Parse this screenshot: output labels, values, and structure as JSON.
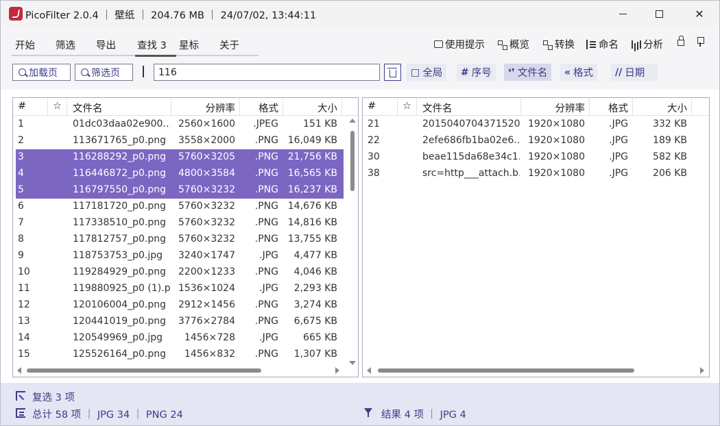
{
  "window": {
    "title": "PicoFilter 2.0.4 ｜ 壁纸 ｜ 204.76 MB ｜ 24/07/02, 13:44:11",
    "controls": {
      "minimize": "",
      "maximize": "",
      "close": "✕"
    }
  },
  "menu": {
    "tabs": [
      {
        "label": "开始"
      },
      {
        "label": "筛选"
      },
      {
        "label": "导出"
      },
      {
        "label": "查找 3",
        "active": true
      },
      {
        "label": "星标"
      },
      {
        "label": "关于"
      }
    ],
    "tools": [
      {
        "label": "使用提示",
        "icon": "speech-bubble-icon"
      },
      {
        "label": "概览",
        "icon": "overview-icon"
      },
      {
        "label": "转换",
        "icon": "convert-icon"
      },
      {
        "label": "命名",
        "icon": "rename-icon"
      },
      {
        "label": "分析",
        "icon": "bar-chart-icon"
      }
    ]
  },
  "search": {
    "load_page_label": "加载页",
    "filter_page_label": "筛选页",
    "query": "116",
    "scopes": [
      {
        "label": "全局",
        "icon": "□",
        "active": false
      },
      {
        "label": "序号",
        "icon": "#",
        "active": false
      },
      {
        "label": "文件名",
        "icon": "❛❜",
        "active": true
      },
      {
        "label": "格式",
        "icon": "«",
        "active": false
      },
      {
        "label": "日期",
        "icon": "//",
        "active": false
      }
    ]
  },
  "left_table": {
    "headers": {
      "index": "#",
      "star": "☆",
      "name": "文件名",
      "resolution": "分辨率",
      "format": "格式",
      "size": "大小"
    },
    "rows": [
      {
        "index": "1",
        "name": "01dc03daa02e900...",
        "resolution": "2560×1600",
        "format": ".JPEG",
        "size": "151 KB",
        "selected": false
      },
      {
        "index": "2",
        "name": "113671765_p0.png",
        "resolution": "3558×2000",
        "format": ".PNG",
        "size": "16,049 KB",
        "selected": false
      },
      {
        "index": "3",
        "name": "116288292_p0.png",
        "resolution": "5760×3205",
        "format": ".PNG",
        "size": "21,756 KB",
        "selected": true
      },
      {
        "index": "4",
        "name": "116446872_p0.png",
        "resolution": "4800×3584",
        "format": ".PNG",
        "size": "16,565 KB",
        "selected": true
      },
      {
        "index": "5",
        "name": "116797550_p0.png",
        "resolution": "5760×3232",
        "format": ".PNG",
        "size": "16,237 KB",
        "selected": true
      },
      {
        "index": "6",
        "name": "117181720_p0.png",
        "resolution": "5760×3232",
        "format": ".PNG",
        "size": "14,676 KB",
        "selected": false
      },
      {
        "index": "7",
        "name": "117338510_p0.png",
        "resolution": "5760×3232",
        "format": ".PNG",
        "size": "14,816 KB",
        "selected": false
      },
      {
        "index": "8",
        "name": "117812757_p0.png",
        "resolution": "5760×3232",
        "format": ".PNG",
        "size": "13,755 KB",
        "selected": false
      },
      {
        "index": "9",
        "name": "118753753_p0.jpg",
        "resolution": "3240×1747",
        "format": ".JPG",
        "size": "4,477 KB",
        "selected": false
      },
      {
        "index": "10",
        "name": "119284929_p0.png",
        "resolution": "2200×1233",
        "format": ".PNG",
        "size": "4,046 KB",
        "selected": false
      },
      {
        "index": "11",
        "name": "119880925_p0 (1).p...",
        "resolution": "1536×1024",
        "format": ".JPG",
        "size": "2,293 KB",
        "selected": false
      },
      {
        "index": "12",
        "name": "120106004_p0.png",
        "resolution": "2912×1456",
        "format": ".PNG",
        "size": "3,274 KB",
        "selected": false
      },
      {
        "index": "13",
        "name": "120441019_p0.png",
        "resolution": "3776×2784",
        "format": ".PNG",
        "size": "6,675 KB",
        "selected": false
      },
      {
        "index": "14",
        "name": "120549969_p0.jpg",
        "resolution": "1456×728",
        "format": ".JPG",
        "size": "665 KB",
        "selected": false
      },
      {
        "index": "15",
        "name": "125526164_p0.png",
        "resolution": "1456×832",
        "format": ".PNG",
        "size": "1,307 KB",
        "selected": false
      }
    ]
  },
  "right_table": {
    "headers": {
      "index": "#",
      "star": "☆",
      "name": "文件名",
      "resolution": "分辨率",
      "format": "格式",
      "size": "大小"
    },
    "rows": [
      {
        "index": "21",
        "name": "2015040704371520...",
        "resolution": "1920×1080",
        "format": ".JPG",
        "size": "332 KB"
      },
      {
        "index": "22",
        "name": "2efe686fb1ba02e6...",
        "resolution": "1920×1080",
        "format": ".JPG",
        "size": "189 KB"
      },
      {
        "index": "30",
        "name": "beae115da68e34c1...",
        "resolution": "1920×1080",
        "format": ".JPG",
        "size": "582 KB"
      },
      {
        "index": "38",
        "name": "src=http___attach.b...",
        "resolution": "1920×1080",
        "format": ".JPG",
        "size": "206 KB"
      }
    ]
  },
  "status": {
    "selected": "复选 3 项",
    "total": "总计 58 项 ｜ JPG 34 ｜ PNG 24",
    "results": "结果 4 项 ｜ JPG 4"
  },
  "colors": {
    "accent": "#3b3b8a",
    "selection": "#7b66c2",
    "statusbar": "#e5e5f4"
  }
}
